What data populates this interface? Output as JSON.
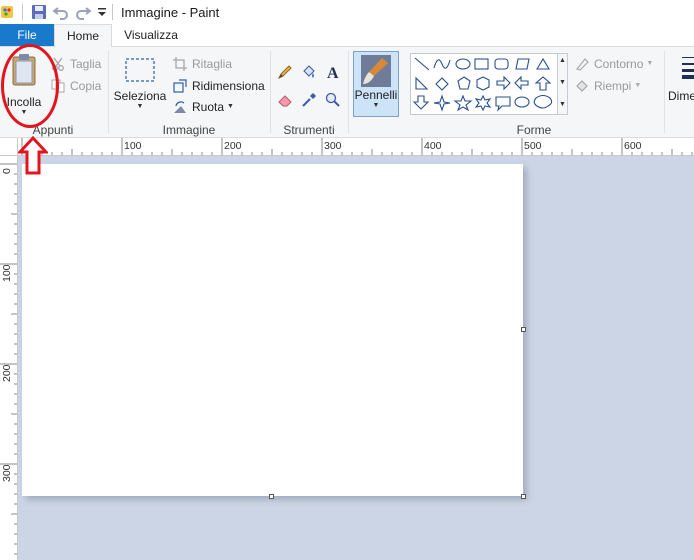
{
  "window": {
    "title": "Immagine - Paint",
    "quick_access": [
      "paint-logo-icon",
      "save-icon",
      "undo-icon",
      "redo-icon",
      "customize-qat-icon"
    ]
  },
  "tabs": [
    {
      "label": "File",
      "active": false,
      "accent": "#1979ca"
    },
    {
      "label": "Home",
      "active": true
    },
    {
      "label": "Visualizza",
      "active": false
    }
  ],
  "ribbon": {
    "clipboard": {
      "group_label": "Appunti",
      "paste_label": "Incolla",
      "cut_label": "Taglia",
      "copy_label": "Copia"
    },
    "image": {
      "group_label": "Immagine",
      "select_label": "Seleziona",
      "crop_label": "Ritaglia",
      "resize_label": "Ridimensiona",
      "rotate_label": "Ruota"
    },
    "tools": {
      "group_label": "Strumenti",
      "items": [
        "pencil-icon",
        "fill-bucket-icon",
        "text-icon",
        "eraser-icon",
        "color-picker-icon",
        "magnifier-icon"
      ]
    },
    "brushes": {
      "label": "Pennelli",
      "selected": true
    },
    "shapes": {
      "group_label": "Forme",
      "outline_label": "Contorno",
      "fill_label": "Riempi"
    },
    "size": {
      "label": "Dime"
    }
  },
  "ruler": {
    "horizontal_labels": [
      "100",
      "200",
      "300",
      "400",
      "500",
      "600"
    ],
    "vertical_labels": [
      "0",
      "100",
      "200",
      "300"
    ]
  },
  "annotation": {
    "color": "#e4141e",
    "arrow_direction": "up"
  },
  "colors": {
    "file_tab": "#1979ca",
    "ribbon_bg": "#f5f6f7",
    "workspace_bg": "#cbd5e5",
    "canvas_bg": "#ffffff",
    "annotation": "#e4141e"
  }
}
